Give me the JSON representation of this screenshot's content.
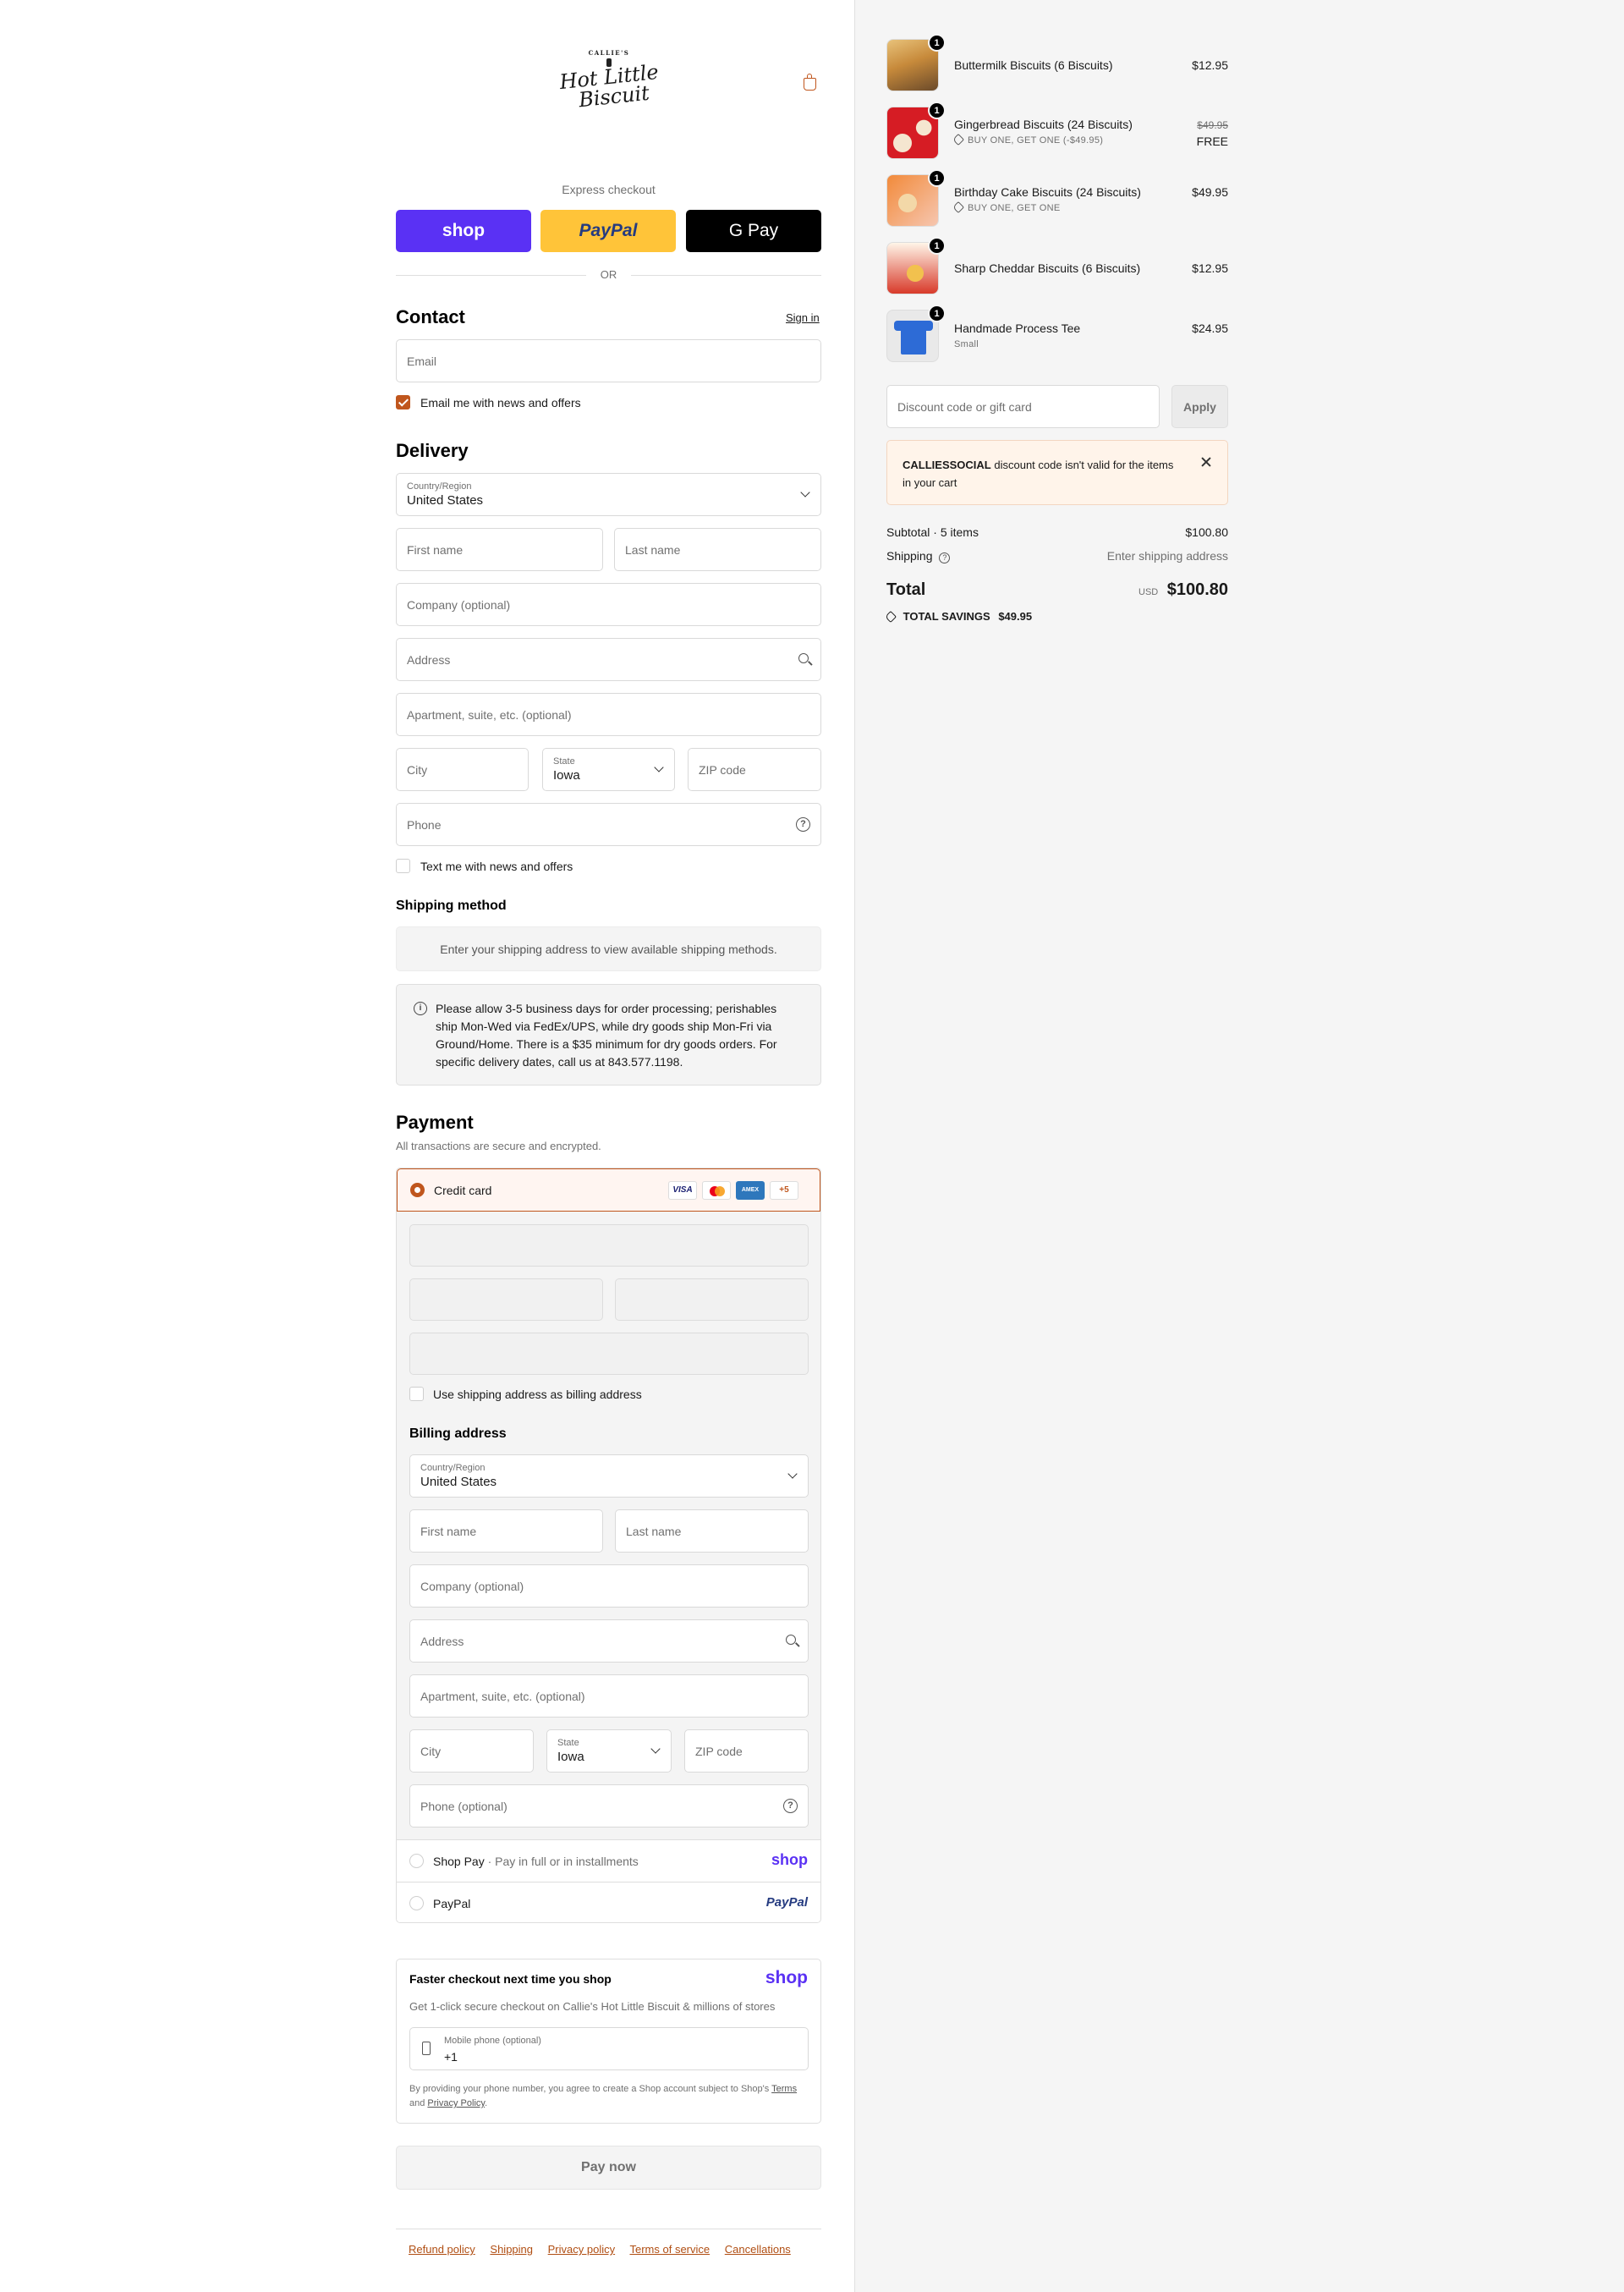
{
  "brand": {
    "logo_top": "CALLIE'S",
    "logo_line1": "Hot Little",
    "logo_line2": "Biscuit"
  },
  "express": {
    "title": "Express checkout",
    "shop_label": "shop",
    "paypal_label": "PayPal",
    "gpay_label": "G Pay",
    "or_label": "OR"
  },
  "contact": {
    "title": "Contact",
    "sign_in": "Sign in",
    "email_placeholder": "Email",
    "news_label": "Email me with news and offers"
  },
  "delivery": {
    "title": "Delivery",
    "country_label": "Country/Region",
    "country_value": "United States",
    "first_name": "First name",
    "last_name": "Last name",
    "company": "Company (optional)",
    "address": "Address",
    "apartment": "Apartment, suite, etc. (optional)",
    "city": "City",
    "state_label": "State",
    "state_value": "Iowa",
    "zip": "ZIP code",
    "phone": "Phone",
    "text_news": "Text me with news and offers"
  },
  "shipping_method": {
    "title": "Shipping method",
    "placeholder": "Enter your shipping address to view available shipping methods.",
    "notice": "Please allow 3-5 business days for order processing; perishables ship Mon-Wed via FedEx/UPS, while dry goods ship Mon-Fri via Ground/Home. There is a $35 minimum for dry goods orders. For specific delivery dates, call us at 843.577.1198."
  },
  "payment": {
    "title": "Payment",
    "subtitle": "All transactions are secure and encrypted.",
    "credit_card": "Credit card",
    "card_brands": [
      "VISA",
      "MC",
      "AMEX",
      "+5"
    ],
    "use_shipping": "Use shipping address as billing address",
    "billing_title": "Billing address",
    "billing_country_label": "Country/Region",
    "billing_country_value": "United States",
    "billing_first": "First name",
    "billing_last": "Last name",
    "billing_company": "Company (optional)",
    "billing_address": "Address",
    "billing_apartment": "Apartment, suite, etc. (optional)",
    "billing_city": "City",
    "billing_state_label": "State",
    "billing_state_value": "Iowa",
    "billing_zip": "ZIP code",
    "billing_phone": "Phone (optional)",
    "shop_pay": "Shop Pay",
    "shop_pay_sep": "·",
    "shop_pay_desc": "Pay in full or in installments",
    "shop_logo": "shop",
    "paypal": "PayPal",
    "paypal_logo": "PayPal"
  },
  "shop_promo": {
    "title": "Faster checkout next time you shop",
    "logo": "shop",
    "desc": "Get 1-click secure checkout on Callie's Hot Little Biscuit & millions of stores",
    "phone_label": "Mobile phone (optional)",
    "phone_value": "+1",
    "legal_prefix": "By providing your phone number, you agree to create a Shop account subject to Shop's",
    "terms": "Terms",
    "and": "and",
    "privacy": "Privacy Policy",
    "period": "."
  },
  "pay_now": "Pay now",
  "footer": [
    "Refund policy",
    "Shipping",
    "Privacy policy",
    "Terms of service",
    "Cancellations"
  ],
  "cart": {
    "items": [
      {
        "qty": "1",
        "name": "Buttermilk Biscuits (6 Biscuits)",
        "price": "$12.95"
      },
      {
        "qty": "1",
        "name": "Gingerbread Biscuits (24 Biscuits)",
        "discount": "BUY ONE, GET ONE (-$49.95)",
        "old_price": "$49.95",
        "price": "FREE"
      },
      {
        "qty": "1",
        "name": "Birthday Cake Biscuits (24 Biscuits)",
        "discount": "BUY ONE, GET ONE",
        "price": "$49.95"
      },
      {
        "qty": "1",
        "name": "Sharp Cheddar Biscuits (6 Biscuits)",
        "price": "$12.95"
      },
      {
        "qty": "1",
        "name": "Handmade Process Tee",
        "variant": "Small",
        "price": "$24.95"
      }
    ],
    "discount_placeholder": "Discount code or gift card",
    "apply": "Apply",
    "error_code": "CALLIESSOCIAL",
    "error_msg": "discount code isn't valid for the items in your cart",
    "subtotal_label": "Subtotal · 5 items",
    "subtotal": "$100.80",
    "shipping_label": "Shipping",
    "shipping_value": "Enter shipping address",
    "total_label": "Total",
    "currency": "USD",
    "total": "$100.80",
    "savings_label": "TOTAL SAVINGS",
    "savings": "$49.95"
  },
  "colors": {
    "accent": "#c0561d",
    "shop": "#5a31f4",
    "paypal_bg": "#ffc439"
  }
}
